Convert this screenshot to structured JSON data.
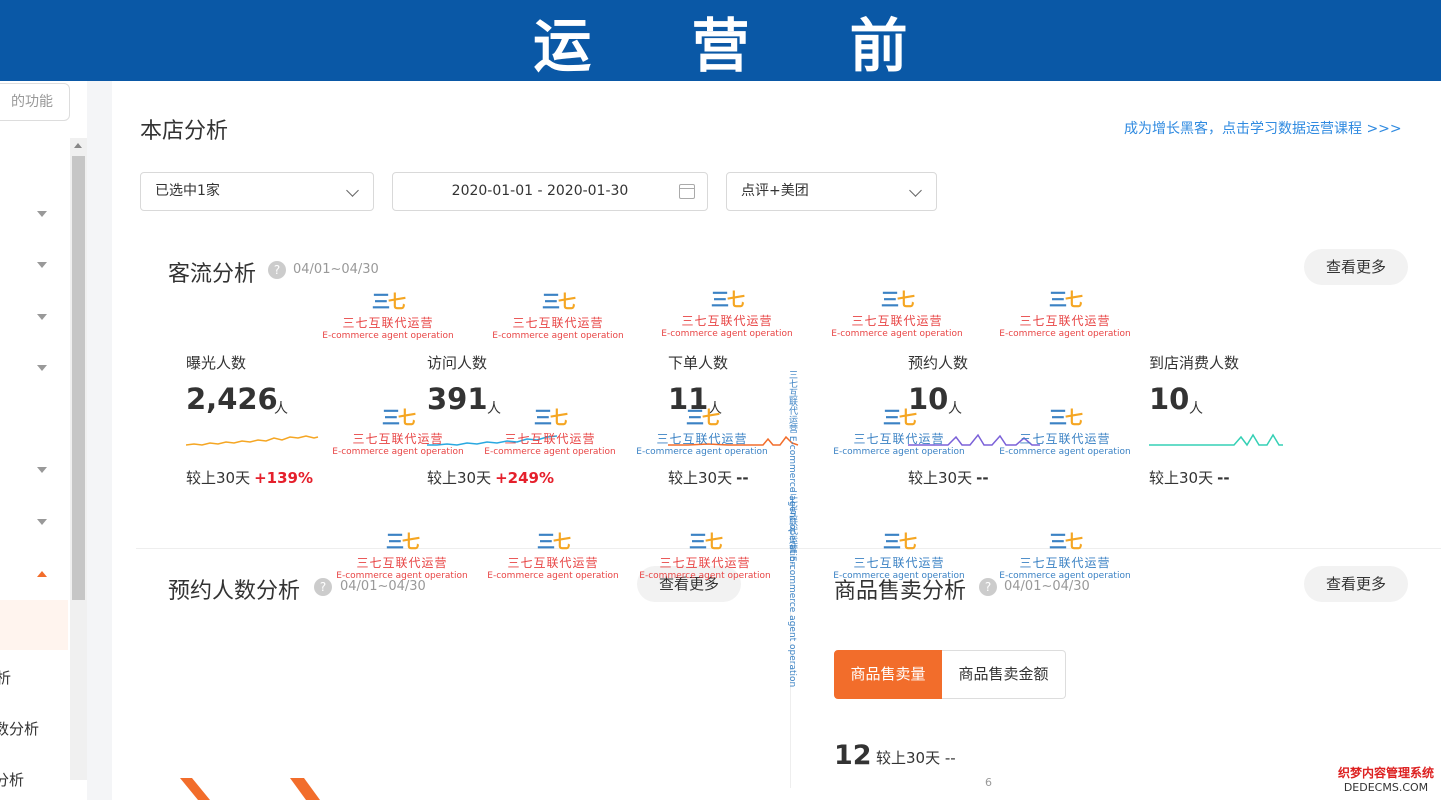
{
  "banner": {
    "title": "运 营 前"
  },
  "sidebar": {
    "top_button": "的功能",
    "items": [
      "析",
      "数分析",
      "分析"
    ]
  },
  "page": {
    "title": "本店分析",
    "promo_link": "成为增长黑客，点击学习数据运营课程 >>>"
  },
  "filters": {
    "store_select": "已选中1家",
    "date_range": "2020-01-01 - 2020-01-30",
    "platform_select": "点评+美团"
  },
  "traffic": {
    "title": "客流分析",
    "date": "04/01~04/30",
    "more_button": "查看更多",
    "metrics": [
      {
        "label": "曝光人数",
        "value": "2,426",
        "unit": "人",
        "compare": "较上30天",
        "change": "+139%",
        "color": "#f5a623"
      },
      {
        "label": "访问人数",
        "value": "391",
        "unit": "人",
        "compare": "较上30天",
        "change": "+249%",
        "color": "#29a8e0"
      },
      {
        "label": "下单人数",
        "value": "11",
        "unit": "人",
        "compare": "较上30天",
        "change": "--",
        "color": "#f26d2b"
      },
      {
        "label": "预约人数",
        "value": "10",
        "unit": "人",
        "compare": "较上30天",
        "change": "--",
        "color": "#7b61d8"
      },
      {
        "label": "到店消费人数",
        "value": "10",
        "unit": "人",
        "compare": "较上30天",
        "change": "--",
        "color": "#35d0b5"
      }
    ]
  },
  "booking": {
    "title": "预约人数分析",
    "date": "04/01~04/30",
    "more_button": "查看更多"
  },
  "sales": {
    "title": "商品售卖分析",
    "date": "04/01~04/30",
    "more_button": "查看更多",
    "tabs": [
      "商品售卖量",
      "商品售卖金额"
    ],
    "value": "12",
    "compare": "较上30天 --",
    "axis_tick": "6"
  },
  "watermark": {
    "logo": "三七",
    "cn": "三七互联代运营",
    "en": "E-commerce agent operation"
  },
  "footer": {
    "site_cn": "织梦内容管理系统",
    "site_en": "DEDECMS.COM"
  }
}
